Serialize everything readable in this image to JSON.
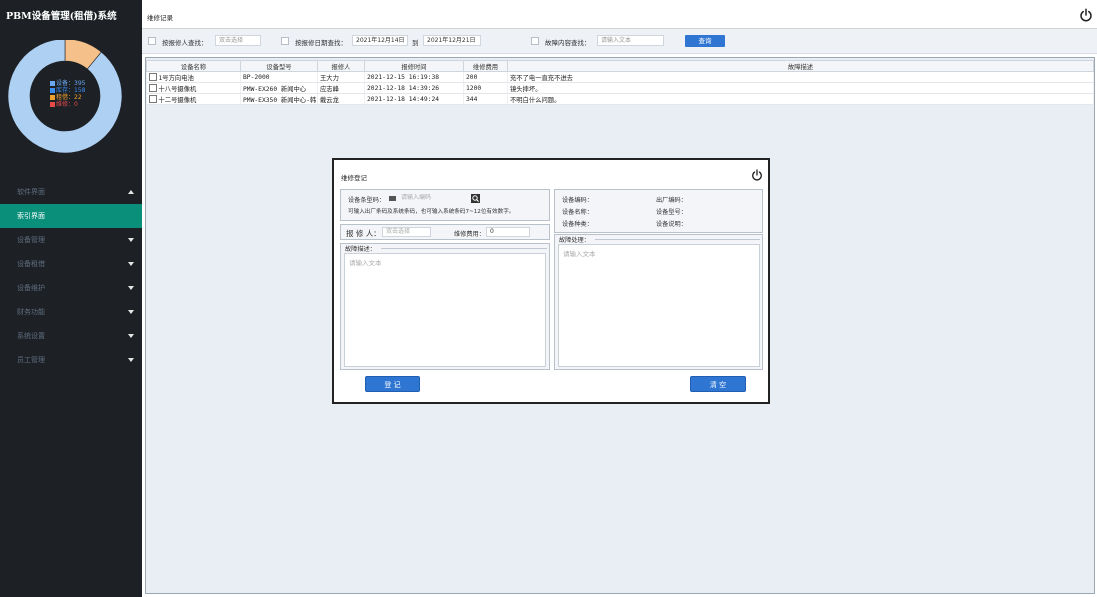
{
  "app": {
    "title": "PBM设备管理(租借)系统"
  },
  "stats": {
    "items": [
      {
        "label": "设备：395",
        "color": "#6aa6f0"
      },
      {
        "label": "库存：158",
        "color": "#3a8cf0"
      },
      {
        "label": "租借：22",
        "color": "#f0a030"
      },
      {
        "label": "维修：0",
        "color": "#e84a4a"
      }
    ],
    "donut": {
      "main_share": 0.89,
      "rent_share": 0.11,
      "main_color": "#aed0f2",
      "rent_color": "#f5c08a"
    }
  },
  "nav": [
    {
      "label": "软件界面",
      "arrow": "up",
      "active": false
    },
    {
      "label": "索引界面",
      "arrow": "",
      "active": true
    },
    {
      "label": "设备管理",
      "arrow": "down",
      "active": false
    },
    {
      "label": "设备租借",
      "arrow": "down",
      "active": false
    },
    {
      "label": "设备维护",
      "arrow": "down",
      "active": false
    },
    {
      "label": "财务功能",
      "arrow": "down",
      "active": false
    },
    {
      "label": "系统设置",
      "arrow": "down",
      "active": false
    },
    {
      "label": "员工管理",
      "arrow": "down",
      "active": false
    }
  ],
  "page": {
    "title": "维修记录"
  },
  "filters": {
    "reporter_label": "按报修人查找：",
    "reporter_placeholder": "双击选择",
    "date_label": "按报修日期查找：",
    "date_from": "2021年12月14日",
    "date_to_label": "到",
    "date_to": "2021年12月21日",
    "desc_label": "故障内容查找：",
    "desc_placeholder": "请输入文本",
    "query_button": "查询"
  },
  "table": {
    "headers": [
      "设备名称",
      "设备型号",
      "报修人",
      "报修时间",
      "维修费用",
      "故障描述"
    ],
    "rows": [
      [
        "1号方向电池",
        "BP-2000",
        "王大力",
        "2021-12-15 16:19:38",
        "200",
        "充不了电一直充不进去"
      ],
      [
        "十八号摄像机",
        "PMW-EX260 新闻中心",
        "应志峰",
        "2021-12-18 14:39:26",
        "1200",
        "镜头摔坏。"
      ],
      [
        "十二号摄像机",
        "PMW-EX350 新闻中心-韩",
        "戴云龙",
        "2021-12-18 14:49:24",
        "344",
        "不明白什么问题。"
      ]
    ]
  },
  "dialog": {
    "title": "维修登记",
    "barcode_label": "设备条型码：",
    "barcode_placeholder": "请输入编码",
    "hint": "可输入出厂条码及系统条码，也可输入系统条码7~12位有效数字。",
    "right_labels": [
      "设备编码：",
      "出厂编码：",
      "设备名称：",
      "设备型号：",
      "设备种类：",
      "设备说明："
    ],
    "reporter_label": "报 修 人：",
    "reporter_placeholder": "双击选择",
    "fee_label": "维修费用：",
    "fee_value": "0",
    "fault_desc_label": "故障描述：",
    "fault_desc_placeholder": "请输入文本",
    "fault_handle_label": "故障处理：",
    "fault_handle_placeholder": "请输入文本",
    "register_button": "登 记",
    "clear_button": "清 空"
  }
}
